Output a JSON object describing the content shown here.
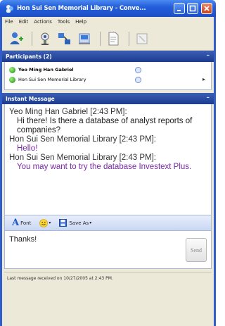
{
  "window": {
    "title": "Hon Sui Sen Memorial Library - Conve..."
  },
  "menu": [
    "File",
    "Edit",
    "Actions",
    "Tools",
    "Help"
  ],
  "participants": {
    "header": "Participants (2)",
    "items": [
      {
        "name": "Yeo Ming Han Gabriel"
      },
      {
        "name": "Hon Sui Sen Memorial Library"
      }
    ]
  },
  "im": {
    "header": "Instant Message",
    "messages": [
      {
        "sender": "Yeo Ming Han Gabriel [2:43 PM]:",
        "text": "Hi there! Is there a database of analyst reports of companies?"
      },
      {
        "sender": "Hon Sui Sen Memorial Library [2:43 PM]:",
        "text": "Hello!"
      },
      {
        "sender": "Hon Sui Sen Memorial Library [2:43 PM]:",
        "text": "You may want to try the database Investext Plus."
      }
    ]
  },
  "format_bar": {
    "font_label": "Font",
    "save_label": "Save As"
  },
  "compose": {
    "text": "Thanks!",
    "send_label": "Send"
  },
  "status": {
    "text": "Last message received on 10/27/2005 at 2:43 PM."
  },
  "colors": {
    "title_bar": "#245edb",
    "pane_header": "#1c3b8f",
    "library_message": "#7a2aa6"
  }
}
